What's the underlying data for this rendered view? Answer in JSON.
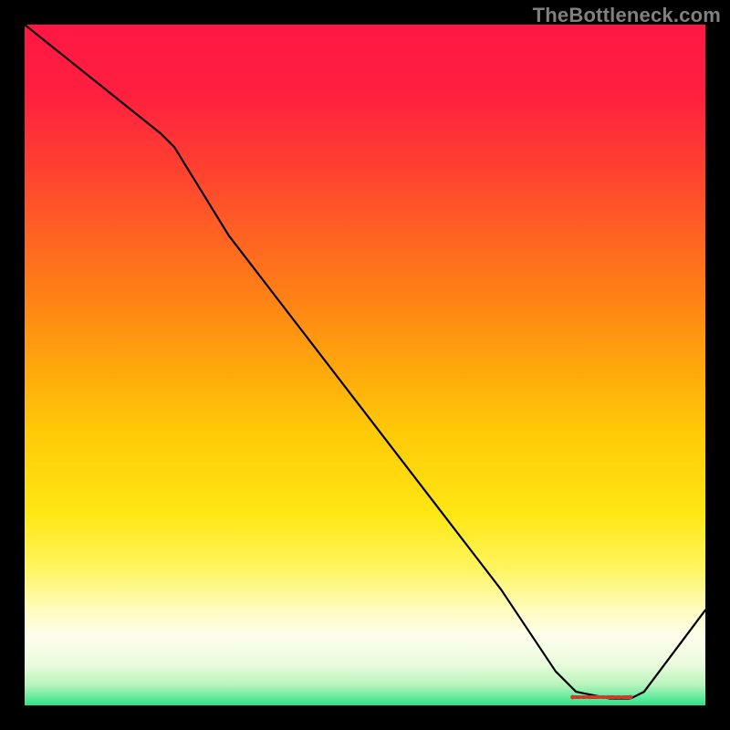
{
  "watermark": "TheBottleneck.com",
  "chart_data": {
    "type": "line",
    "title": "",
    "xlabel": "",
    "ylabel": "",
    "xlim": [
      0,
      100
    ],
    "ylim": [
      0,
      100
    ],
    "background_gradient": {
      "stops": [
        {
          "offset": 0.0,
          "color": "#ff1744"
        },
        {
          "offset": 0.1,
          "color": "#ff1f3f"
        },
        {
          "offset": 0.2,
          "color": "#ff3d32"
        },
        {
          "offset": 0.3,
          "color": "#ff5f24"
        },
        {
          "offset": 0.4,
          "color": "#ff8116"
        },
        {
          "offset": 0.5,
          "color": "#ffa60c"
        },
        {
          "offset": 0.6,
          "color": "#ffca08"
        },
        {
          "offset": 0.72,
          "color": "#ffe713"
        },
        {
          "offset": 0.8,
          "color": "#fff561"
        },
        {
          "offset": 0.86,
          "color": "#fffcbf"
        },
        {
          "offset": 0.9,
          "color": "#fdfeed"
        },
        {
          "offset": 0.94,
          "color": "#e9fcdc"
        },
        {
          "offset": 0.97,
          "color": "#b8f4bb"
        },
        {
          "offset": 1.0,
          "color": "#2ee38b"
        }
      ]
    },
    "series": [
      {
        "name": "curve",
        "color": "#000000",
        "stroke_width": 2.2,
        "x": [
          0,
          10,
          20,
          22,
          30,
          40,
          50,
          60,
          70,
          78,
          81,
          86,
          89,
          91,
          100
        ],
        "values": [
          100,
          92,
          84,
          82,
          69,
          56,
          43,
          30,
          17,
          5,
          2,
          1,
          1,
          2,
          14
        ]
      }
    ],
    "flat_marker": {
      "color": "#cc3b2f",
      "y": 1.2,
      "x_start": 80.5,
      "x_end": 89.0,
      "dot_radius": 2.4,
      "dash": [
        8,
        3,
        3,
        3,
        12,
        3,
        3,
        3
      ]
    }
  }
}
